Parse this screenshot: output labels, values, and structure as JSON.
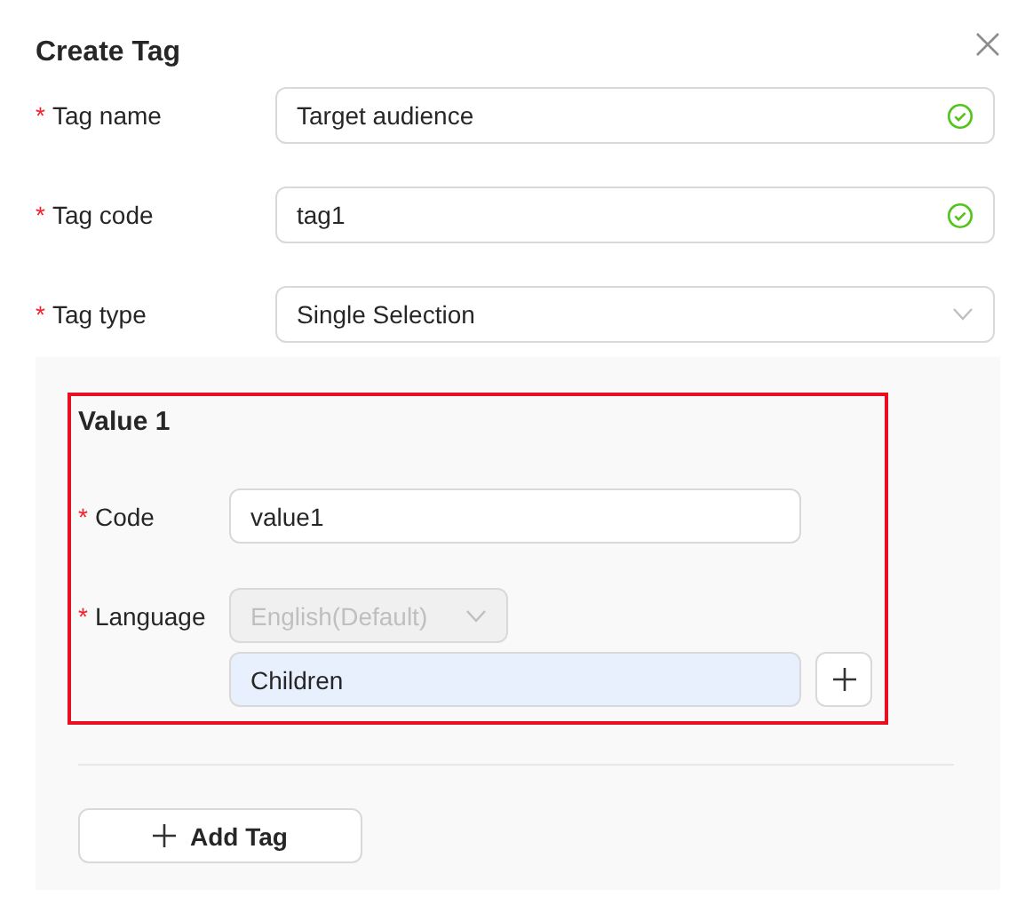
{
  "dialog": {
    "title": "Create Tag"
  },
  "fields": [
    {
      "label": "Tag name",
      "required_mark": "*",
      "kind": "input",
      "value": "Target audience",
      "valid": true
    },
    {
      "label": "Tag code",
      "required_mark": "*",
      "kind": "input",
      "value": "tag1",
      "valid": true
    },
    {
      "label": "Tag type",
      "required_mark": "*",
      "kind": "select",
      "value": "Single Selection"
    }
  ],
  "value_section": {
    "title": "Value 1",
    "highlighted": true,
    "code": {
      "label": "Code",
      "required_mark": "*",
      "value": "value1"
    },
    "language": {
      "label": "Language",
      "required_mark": "*",
      "value": "English(Default)",
      "disabled": true
    },
    "translation": {
      "value": "Children"
    }
  },
  "add_button": {
    "label": "Add Tag"
  }
}
